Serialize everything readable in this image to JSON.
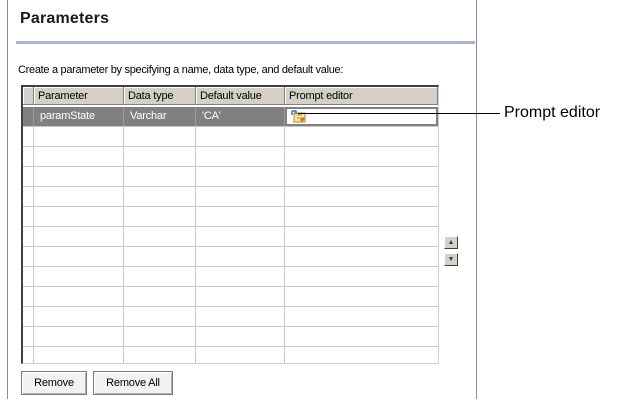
{
  "panel": {
    "title": "Parameters",
    "instruction": "Create a parameter by specifying a name, data type, and default value:"
  },
  "table": {
    "columns": [
      "Parameter",
      "Data type",
      "Default value",
      "Prompt editor"
    ],
    "rows": [
      {
        "parameter": "paramState",
        "data_type": "Varchar",
        "default_value": "'CA'",
        "prompt_editor": "prompt-editor-icon",
        "selected": true
      }
    ],
    "empty_row_count": 12
  },
  "scroll": {
    "up_icon": "arrow-up-icon",
    "down_icon": "arrow-down-icon"
  },
  "buttons": {
    "remove": "Remove",
    "remove_all": "Remove All"
  },
  "callout": {
    "label": "Prompt editor"
  },
  "colors": {
    "selection": "#808080",
    "title_rule": "#a7b7d3",
    "header_bg": "#d4d0c8"
  }
}
